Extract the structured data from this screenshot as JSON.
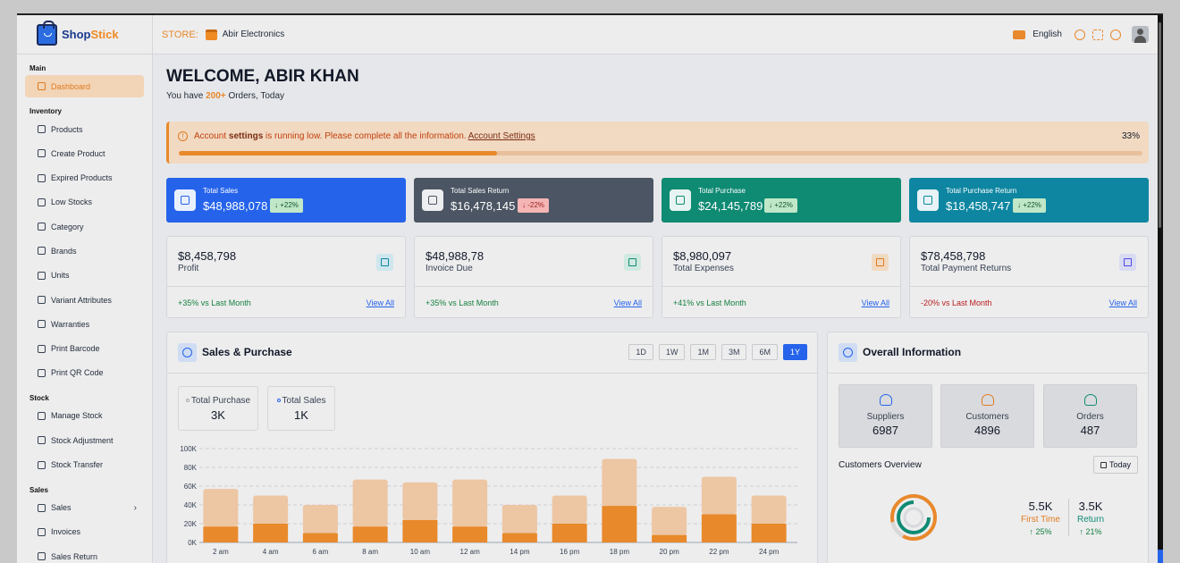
{
  "brand": {
    "name_a": "Shop",
    "name_b": "Stick"
  },
  "sidebar": {
    "sections": [
      {
        "label": "Main"
      },
      {
        "label": "Inventory"
      },
      {
        "label": "Stock"
      },
      {
        "label": "Sales"
      }
    ],
    "items": [
      {
        "label": "Dashboard"
      },
      {
        "label": "Products"
      },
      {
        "label": "Create Product"
      },
      {
        "label": "Expired Products"
      },
      {
        "label": "Low Stocks"
      },
      {
        "label": "Category"
      },
      {
        "label": "Brands"
      },
      {
        "label": "Units"
      },
      {
        "label": "Variant Attributes"
      },
      {
        "label": "Warranties"
      },
      {
        "label": "Print Barcode"
      },
      {
        "label": "Print QR Code"
      },
      {
        "label": "Manage Stock"
      },
      {
        "label": "Stock Adjustment"
      },
      {
        "label": "Stock Transfer"
      },
      {
        "label": "Sales"
      },
      {
        "label": "Invoices"
      },
      {
        "label": "Sales Return"
      }
    ]
  },
  "header": {
    "store_label": "STORE:",
    "store_name": "Abir Electronics",
    "language": "English"
  },
  "welcome": {
    "title": "WELCOME, ABIR KHAN",
    "prefix": "You have",
    "count": "200+",
    "suffix": "Orders, Today"
  },
  "alert": {
    "text_a": "Account",
    "text_b": "settings",
    "text_c": "is running low. Please complete all the information.",
    "link": "Account Settings",
    "percent": "33%",
    "progress": 0.33
  },
  "kpis": [
    {
      "label": "Total Sales",
      "value": "$48,988,078",
      "badge": "↓ +22%",
      "color": "#2563eb"
    },
    {
      "label": "Total Sales Return",
      "value": "$16,478,145",
      "badge": "↓ -22%",
      "color": "#4b5563"
    },
    {
      "label": "Total Purchase",
      "value": "$24,145,789",
      "badge": "↓ +22%",
      "color": "#0f8a73"
    },
    {
      "label": "Total Purchase Return",
      "value": "$18,458,747",
      "badge": "↓ +22%",
      "color": "#0e86a1"
    }
  ],
  "stats": [
    {
      "value": "$8,458,798",
      "label": "Profit",
      "change": "+35% vs Last Month",
      "link": "View All"
    },
    {
      "value": "$48,988,78",
      "label": "Invoice Due",
      "change": "+35% vs Last Month",
      "link": "View All"
    },
    {
      "value": "$8,980,097",
      "label": "Total Expenses",
      "change": "+41% vs Last Month",
      "link": "View All"
    },
    {
      "value": "$78,458,798",
      "label": "Total Payment Returns",
      "change": "-20% vs Last Month",
      "link": "View All"
    }
  ],
  "sales_purchase": {
    "title": "Sales & Purchase",
    "ranges": [
      "1D",
      "1W",
      "1M",
      "3M",
      "6M",
      "1Y"
    ],
    "active_range": "1Y",
    "legend": [
      {
        "label": "Total Purchase",
        "value": "3K"
      },
      {
        "label": "Total Sales",
        "value": "1K"
      }
    ]
  },
  "overall": {
    "title": "Overall Information",
    "tiles": [
      {
        "label": "Suppliers",
        "value": "6987",
        "color": "#2563eb"
      },
      {
        "label": "Customers",
        "value": "4896",
        "color": "#e07b1f"
      },
      {
        "label": "Orders",
        "value": "487",
        "color": "#0f8a73"
      }
    ],
    "customers_overview": "Customers Overview",
    "today": "Today",
    "first_time": {
      "value": "5.5K",
      "label": "First Time",
      "pct": "↑ 25%"
    },
    "return": {
      "value": "3.5K",
      "label": "Return",
      "pct": "↑ 21%"
    }
  },
  "chart_data": {
    "type": "bar",
    "categories": [
      "2 am",
      "4 am",
      "6 am",
      "8 am",
      "10 am",
      "12 am",
      "14 pm",
      "16 pm",
      "18 pm",
      "20 pm",
      "22 pm",
      "24 pm"
    ],
    "series": [
      {
        "values": [
          17,
          20,
          10,
          17,
          24,
          17,
          10,
          20,
          39,
          8,
          30,
          20
        ],
        "color": "#e8892b"
      },
      {
        "values": [
          40,
          30,
          30,
          50,
          40,
          50,
          30,
          30,
          50,
          30,
          40,
          30
        ],
        "color": "#edc6a3"
      }
    ],
    "stacked": true,
    "yticks": [
      "0K",
      "20K",
      "40K",
      "60K",
      "80K",
      "100K"
    ],
    "ylim": [
      0,
      100
    ],
    "grid": true
  }
}
